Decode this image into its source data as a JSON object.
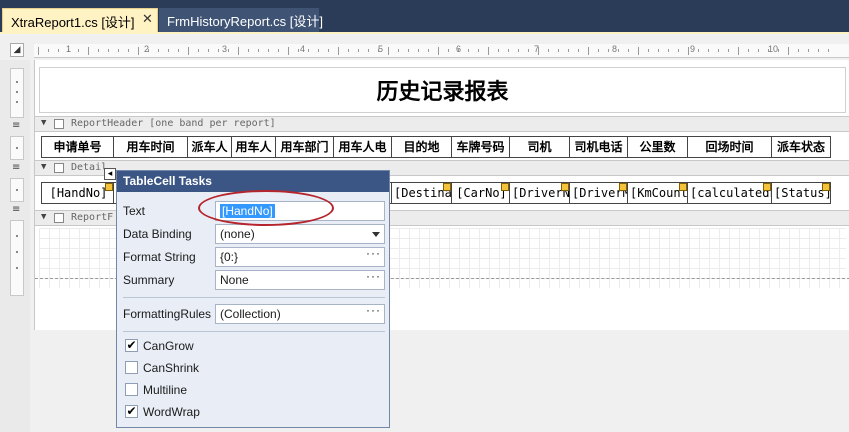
{
  "tabs": [
    {
      "label": "XtraReport1.cs [设计]",
      "close": "✕"
    },
    {
      "label": "FrmHistoryReport.cs [设计]"
    }
  ],
  "ruler": {
    "numbers": [
      "1",
      "2",
      "3",
      "4",
      "5",
      "6",
      "7",
      "8",
      "9",
      "10"
    ]
  },
  "report": {
    "title": "历史记录报表",
    "report_header_band": "ReportHeader [one band per report]",
    "detail_band": "Detail",
    "footer_band": "ReportF",
    "headers": [
      "申请单号",
      "用车时间",
      "派车人",
      "用车人",
      "用车部门",
      "用车人电",
      "目的地",
      "车牌号码",
      "司机",
      "司机电话",
      "公里数",
      "回场时间",
      "派车状态"
    ],
    "details": [
      "[HandNo]",
      "",
      "",
      "",
      "",
      "",
      "[Destina",
      "[CarNo]",
      "[DriverN",
      "[DriverM",
      "[KmCount",
      "[calculatedF",
      "[Status]"
    ]
  },
  "panel": {
    "title": "TableCell Tasks",
    "text_label": "Text",
    "text_value": "[HandNo]",
    "binding_label": "Data Binding",
    "binding_value": "(none)",
    "format_label": "Format String",
    "format_value": "{0:}",
    "summary_label": "Summary",
    "summary_value": "None",
    "rules_label": "FormattingRules",
    "rules_value": "(Collection)",
    "ellipsis": "···",
    "checkboxes": [
      {
        "label": "CanGrow",
        "checked": true
      },
      {
        "label": "CanShrink",
        "checked": false
      },
      {
        "label": "Multiline",
        "checked": false
      },
      {
        "label": "WordWrap",
        "checked": true
      }
    ]
  },
  "colors": {
    "tab_active": "#fff3c4",
    "panel_title": "#3b5685",
    "highlight": "#b5252e"
  }
}
